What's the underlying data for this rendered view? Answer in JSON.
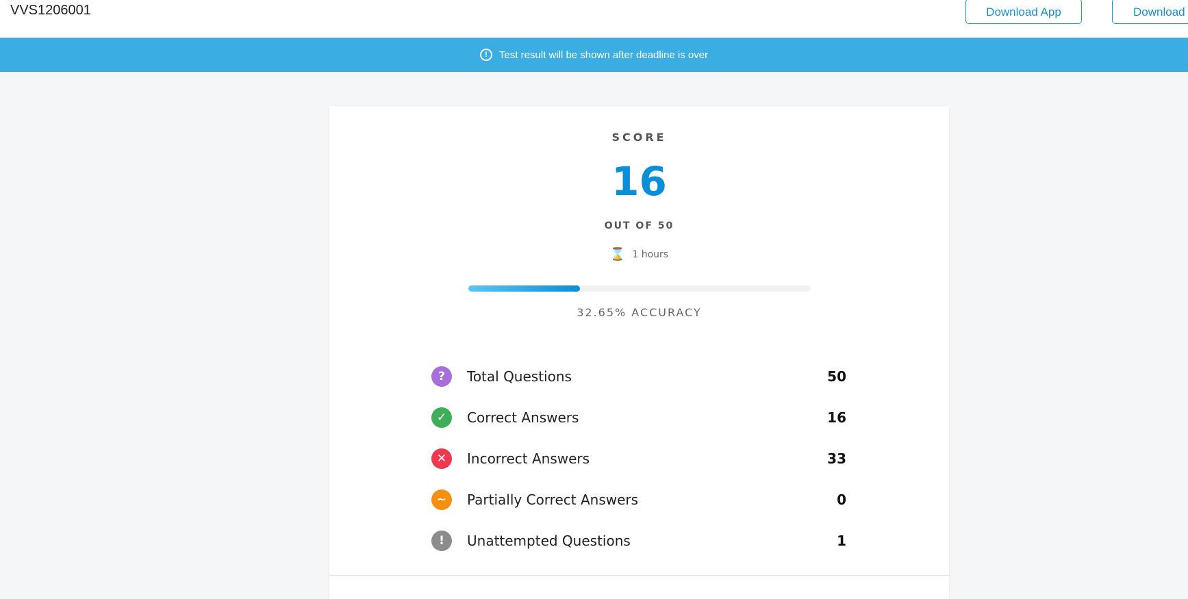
{
  "header": {
    "title": "VVS1206001",
    "download_app_label": "Download App",
    "download_label": "Download"
  },
  "banner": {
    "icon": "exclamation-circle-icon",
    "message": "Test result will be shown after deadline is over"
  },
  "result": {
    "score_label": "SCORE",
    "score": "16",
    "out_of": "OUT OF 50",
    "duration": "1 hours",
    "accuracy_percent": 32.65,
    "accuracy_text": "32.65% ACCURACY"
  },
  "stats": [
    {
      "label": "Total Questions",
      "value": "50",
      "icon": "question-icon",
      "glyph": "?",
      "color": "#a86fdb"
    },
    {
      "label": "Correct Answers",
      "value": "16",
      "icon": "check-icon",
      "glyph": "✓",
      "color": "#3fae5a"
    },
    {
      "label": "Incorrect Answers",
      "value": "33",
      "icon": "cross-icon",
      "glyph": "✕",
      "color": "#f0384f"
    },
    {
      "label": "Partially Correct Answers",
      "value": "0",
      "icon": "tilde-icon",
      "glyph": "~",
      "color": "#f8900f"
    },
    {
      "label": "Unattempted Questions",
      "value": "1",
      "icon": "exclamation-icon",
      "glyph": "!",
      "color": "#8c8c8c"
    }
  ],
  "colors": {
    "accent": "#0a8ed8",
    "banner": "#3aaee2",
    "hourglass": "#f08a00"
  }
}
